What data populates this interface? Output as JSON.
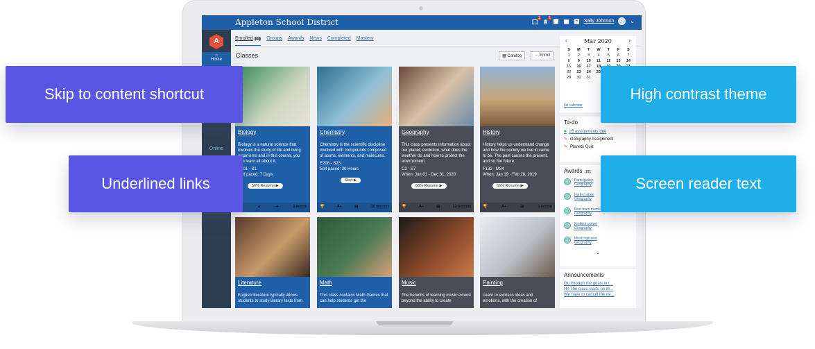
{
  "app": {
    "title": "Appleton School District",
    "user": "Sally Johnson",
    "notif_badge_1": "1",
    "notif_badge_2": "1"
  },
  "sidebar": {
    "logo": "A",
    "home": "Home",
    "online": "Online"
  },
  "tabs": [
    {
      "label": "Enrolled",
      "count": "16"
    },
    {
      "label": "Groups"
    },
    {
      "label": "Awards"
    },
    {
      "label": "News"
    },
    {
      "label": "Completed"
    },
    {
      "label": "Mastery"
    }
  ],
  "classes": {
    "heading": "Classes",
    "catalog": "Catalog",
    "enroll": "Enroll"
  },
  "cards": [
    {
      "name": "Biology",
      "desc": "Biology is a natural science that involves the study of life and living organisms and in this course, you can learn all about it.",
      "code": "B101 - S1",
      "meta": "Self paced: 7 Days",
      "action": "50% Resume ▶",
      "lessons": "1 lesson"
    },
    {
      "name": "Chemistry",
      "desc": "Chemistry is the scientific discipline involved with compounds composed of atoms, elements, and molecules.",
      "code": "E208 - S23",
      "meta": "Self paced: 30 Hours",
      "action": "Start ▶",
      "lessons": "10 lessons"
    },
    {
      "name": "Geography",
      "desc": "This class presents information about our planet, evolution, what does the weather do and how to protect the environment.",
      "code": "C2 - S7",
      "meta": "When: Jun 01 - Dec 31, 2020",
      "action": "68% Resume ▶",
      "lessons": "12 lessons"
    },
    {
      "name": "History",
      "desc": "History helps us understand change and how the society we live in came to be. The past causes the present, and so the future.",
      "code": "F132 - M34",
      "meta": "When: Jan 19 - Feb 28, 2019",
      "action": "66% Resume ▶",
      "lessons": "1 lesson"
    },
    {
      "name": "Literature",
      "desc": "English literature typically allows students to study literary texts from"
    },
    {
      "name": "Math",
      "desc": "This class contains Math Games that can help students get the"
    },
    {
      "name": "Music",
      "desc": "The benefits of learning music extend beyond the ability to create"
    },
    {
      "name": "Painting",
      "desc": "Learn to express ideas and emotions, with the creation of"
    }
  ],
  "calendar": {
    "month": "Mar 2020",
    "days": [
      "S",
      "M",
      "T",
      "W",
      "T",
      "F",
      "S"
    ],
    "rows": [
      [
        "1",
        "2",
        "3",
        "4",
        "5",
        "6",
        "7"
      ],
      [
        "8",
        "9",
        "10",
        "11",
        "12",
        "13",
        "14"
      ],
      [
        "15",
        "16",
        "17",
        "18",
        "19",
        "20",
        "21"
      ],
      [
        "22",
        "23",
        "24",
        "25",
        "26",
        "27",
        "28"
      ],
      [
        "29",
        "30",
        "31",
        "",
        "",
        "",
        ""
      ]
    ],
    "full_link": "full calendar"
  },
  "todo": {
    "title": "To-do",
    "items": [
      "25 assignments due",
      "Geography Assignment",
      "Planets Quiz"
    ]
  },
  "awards": {
    "title": "Awards",
    "count": "101",
    "items": [
      {
        "name": "Participation",
        "course": "Geography"
      },
      {
        "name": "Perfect atten",
        "course": "Geography"
      },
      {
        "name": "Best team member",
        "course": "Geography"
      },
      {
        "name": "Problem solver",
        "course": "Geography"
      },
      {
        "name": "Most improved",
        "course": "Geography"
      }
    ]
  },
  "announcements": {
    "title": "Announcements",
    "items": [
      "Go through the goals in t...",
      "Hi! The class starts on M...",
      "We have to cancel the ne..."
    ]
  },
  "callouts": {
    "skip": "Skip to content shortcut",
    "contrast": "High contrast theme",
    "links": "Underlined links",
    "reader": "Screen reader text"
  },
  "colors": {
    "topbar": "#1f5fa8",
    "sidebar": "#2d3e50",
    "purple": "#5a56e3",
    "cyan": "#1eaee8"
  }
}
